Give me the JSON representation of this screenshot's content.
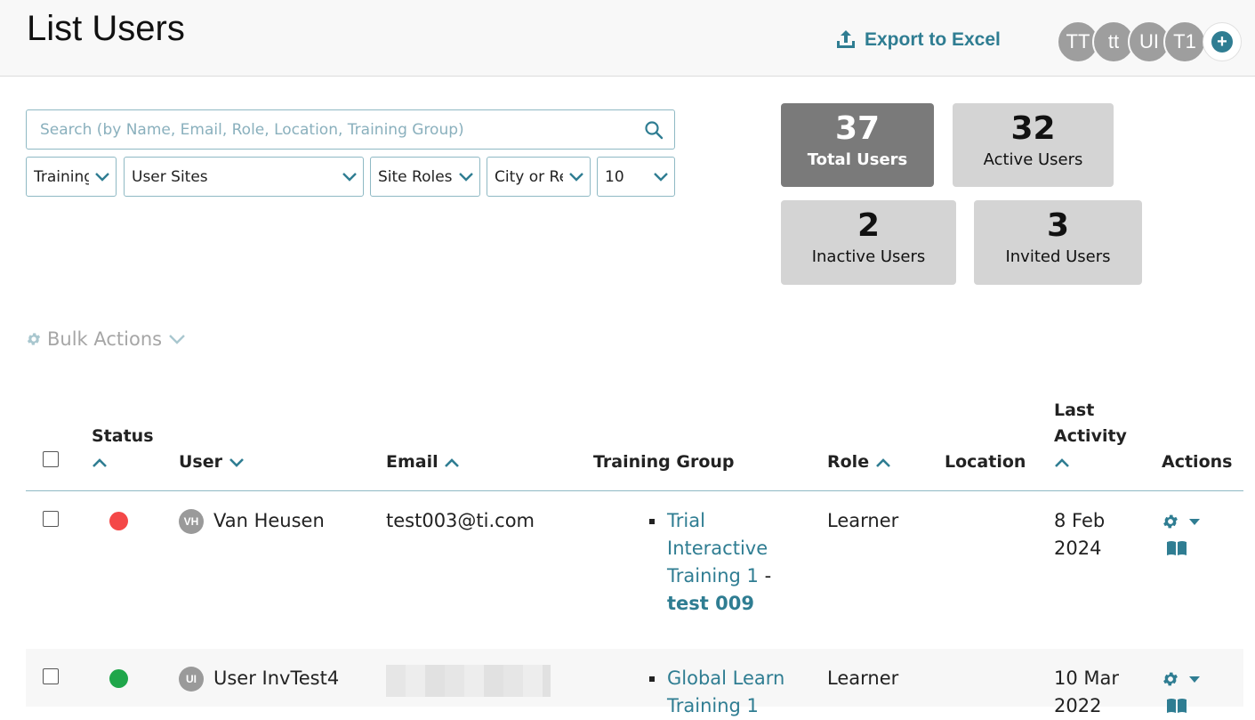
{
  "header": {
    "title": "List Users",
    "export_label": "Export to Excel",
    "avatars": [
      "TT",
      "tt",
      "UI",
      "T1"
    ],
    "add_label": "+"
  },
  "search": {
    "placeholder": "Search (by Name, Email, Role, Location, Training Group)"
  },
  "filters": {
    "training": "Training",
    "user_sites": "User Sites",
    "site_roles": "Site Roles",
    "city": "City or Region",
    "page_size": "10"
  },
  "stats": {
    "total": {
      "value": "37",
      "label": "Total Users"
    },
    "active": {
      "value": "32",
      "label": "Active Users"
    },
    "inactive": {
      "value": "2",
      "label": "Inactive Users"
    },
    "invited": {
      "value": "3",
      "label": "Invited Users"
    }
  },
  "bulk_actions_label": "Bulk Actions",
  "table": {
    "headers": {
      "status": "Status",
      "user": "User",
      "email": "Email",
      "training_group": "Training Group",
      "role": "Role",
      "location": "Location",
      "last_activity_1": "Last",
      "last_activity_2": "Activity",
      "actions": "Actions"
    },
    "rows": [
      {
        "status_color": "#f44848",
        "initials": "VH",
        "name": "Van Heusen",
        "email": "test003@ti.com",
        "training_lines": [
          "Trial",
          "Interactive",
          "Training 1"
        ],
        "training_sep": "-",
        "training_sub": "test 009",
        "role": "Learner",
        "date_1": "8 Feb",
        "date_2": "2024"
      },
      {
        "status_color": "#1fa64a",
        "initials": "UI",
        "name": "User InvTest4",
        "email": "",
        "training_lines": [
          "Global Learn",
          "Training 1"
        ],
        "role": "Learner",
        "date_1": "10 Mar",
        "date_2": "2022"
      }
    ]
  }
}
